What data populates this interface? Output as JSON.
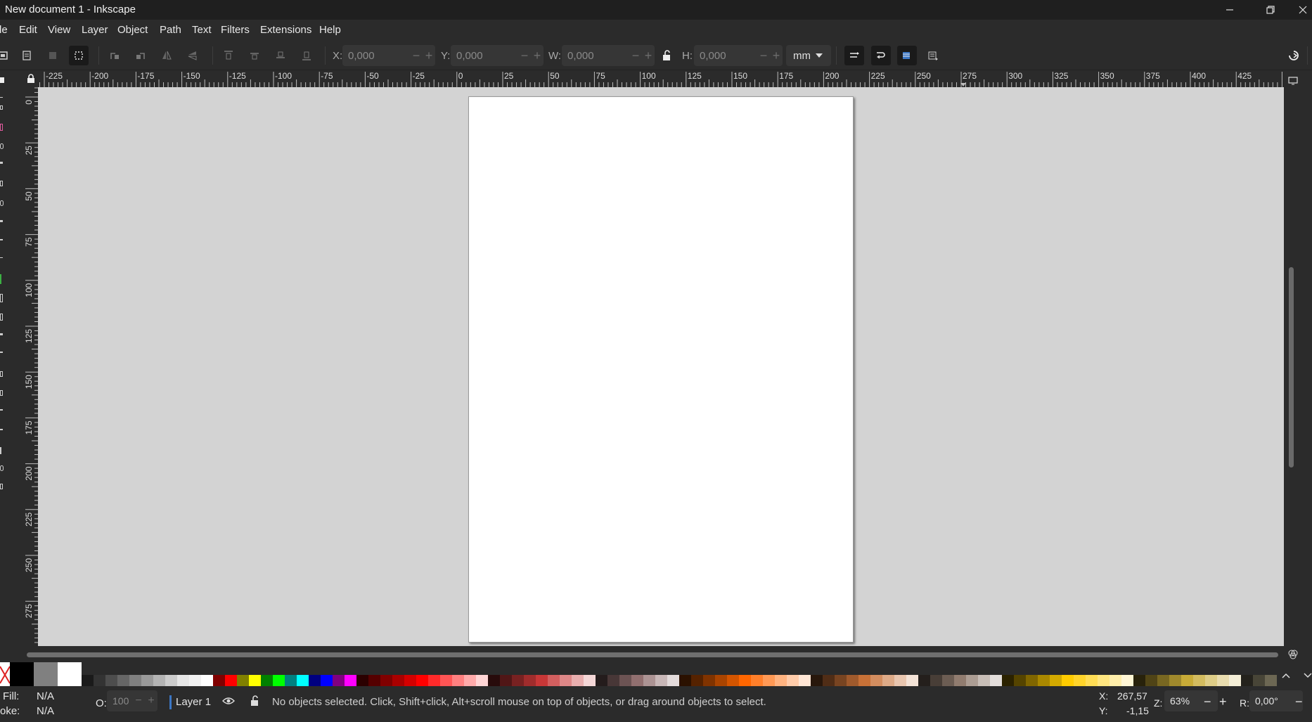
{
  "window": {
    "title": "New document 1 - Inkscape",
    "controls": [
      "minimize",
      "restore",
      "close"
    ]
  },
  "menu": {
    "items": [
      "le",
      "Edit",
      "View",
      "Layer",
      "Object",
      "Path",
      "Text",
      "Filters",
      "Extensions",
      "Help"
    ]
  },
  "toolbar": {
    "x_label": "X:",
    "x_value": "0,000",
    "y_label": "Y:",
    "y_value": "0,000",
    "w_label": "W:",
    "w_value": "0,000",
    "h_label": "H:",
    "h_value": "0,000",
    "unit": "mm",
    "minus": "−",
    "plus": "+"
  },
  "hruler": {
    "labels": [
      "-225",
      "-200",
      "-175",
      "-150",
      "-125",
      "-100",
      "-75",
      "-50",
      "-25",
      "0",
      "25",
      "50",
      "75",
      "100",
      "125",
      "150",
      "175",
      "200",
      "225",
      "250",
      "275",
      "300",
      "325",
      "350",
      "375",
      "400",
      "425"
    ]
  },
  "vruler": {
    "labels": [
      "0",
      "25",
      "50",
      "75",
      "100",
      "125",
      "150",
      "175",
      "200",
      "225",
      "250",
      "275"
    ]
  },
  "palette": {
    "colors": [
      "#000000",
      "#808080",
      "#ffffff",
      "#1a1a1a",
      "#333333",
      "#4d4d4d",
      "#666666",
      "#808080",
      "#999999",
      "#b3b3b3",
      "#cccccc",
      "#e6e6e6",
      "#f2f2f2",
      "#ffffff",
      "#800000",
      "#ff0000",
      "#808000",
      "#ffff00",
      "#008000",
      "#00ff00",
      "#008080",
      "#00ffff",
      "#000080",
      "#0000ff",
      "#800080",
      "#ff00ff",
      "#2b0000",
      "#550000",
      "#800000",
      "#aa0000",
      "#d40000",
      "#ff0000",
      "#ff2a2a",
      "#ff5555",
      "#ff8080",
      "#ffaaaa",
      "#ffd5d5",
      "#280b0b",
      "#501616",
      "#782121",
      "#a02c2c",
      "#c83737",
      "#d35f5f",
      "#de8787",
      "#e9afaf",
      "#f4d7d7",
      "#241c1c",
      "#483737",
      "#6c5353",
      "#916f6f",
      "#ac9393",
      "#c8b7b7",
      "#e3dbdb",
      "#2b1100",
      "#552200",
      "#803300",
      "#aa4400",
      "#d45500",
      "#ff6600",
      "#ff7f2a",
      "#ff9955",
      "#ffb380",
      "#ffccaa",
      "#ffe6d5",
      "#28170b",
      "#502d16",
      "#784421",
      "#a05a2c",
      "#c87137",
      "#d38d5f",
      "#deaa87",
      "#e9c6af",
      "#f4e3d7",
      "#241f1c",
      "#483e37",
      "#6c5d53",
      "#917c6f",
      "#ac9d93",
      "#c8beb7",
      "#e3dedb",
      "#2b2200",
      "#554400",
      "#806600",
      "#aa8800",
      "#d4aa00",
      "#ffcc00",
      "#ffd42a",
      "#ffdd55",
      "#ffe680",
      "#ffeeaa",
      "#fff6d5",
      "#28220b",
      "#504416",
      "#786721",
      "#a0892c",
      "#c8ab37",
      "#d3bc5f",
      "#decd87",
      "#e9ddaf",
      "#f4eed7",
      "#24221c",
      "#484537",
      "#6c6753"
    ]
  },
  "status": {
    "fill_label": "Fill:",
    "fill_value": "N/A",
    "stroke_label": "oke:",
    "stroke_value": "N/A",
    "opacity_label": "O:",
    "opacity_value": "100",
    "layer": "Layer 1",
    "message": "No objects selected. Click, Shift+click, Alt+scroll mouse on top of objects, or drag around objects to select.",
    "x_label": "X:",
    "x_value": "267,57",
    "y_label": "Y:",
    "y_value": "-1,15",
    "zoom_label": "Z:",
    "zoom_value": "63%",
    "rotate_label": "R:",
    "rotate_value": "0,00°"
  }
}
